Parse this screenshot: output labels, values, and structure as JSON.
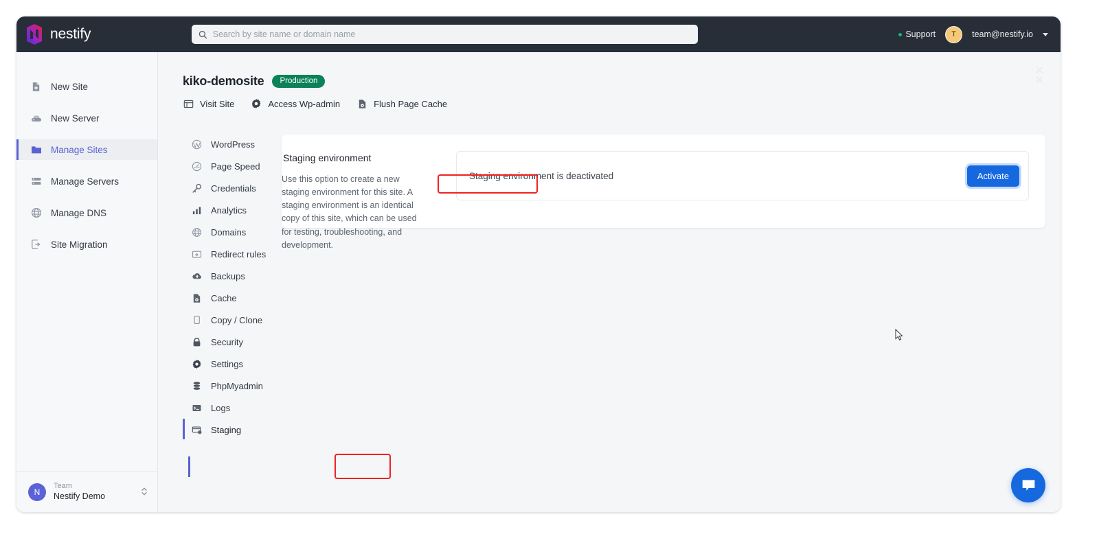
{
  "brand": {
    "name": "nestify",
    "logo_icon": "nestify-logo-icon"
  },
  "topbar": {
    "search": {
      "placeholder": "Search by site name or domain name",
      "value": "",
      "icon": "search-icon"
    },
    "support_label": "Support",
    "user": {
      "avatar_initial": "T",
      "email": "team@nestify.io"
    }
  },
  "sidebar": {
    "items": [
      {
        "label": "New Site",
        "icon": "file-plus-icon",
        "active": false
      },
      {
        "label": "New Server",
        "icon": "server-add-icon",
        "active": false
      },
      {
        "label": "Manage Sites",
        "icon": "folder-icon",
        "active": true
      },
      {
        "label": "Manage Servers",
        "icon": "servers-icon",
        "active": false
      },
      {
        "label": "Manage DNS",
        "icon": "globe-icon",
        "active": false
      },
      {
        "label": "Site Migration",
        "icon": "migration-icon",
        "active": false
      }
    ],
    "team": {
      "avatar_initial": "N",
      "label": "Team",
      "name": "Nestify Demo",
      "switch_icon": "up-down-chevrons-icon"
    }
  },
  "page": {
    "title": "kiko-demosite",
    "env_badge": "Production",
    "close_icon": "close-icon",
    "actions": [
      {
        "label": "Visit Site",
        "icon": "browser-window-icon"
      },
      {
        "label": "Access Wp-admin",
        "icon": "gear-icon"
      },
      {
        "label": "Flush Page Cache",
        "icon": "cache-refresh-icon"
      }
    ]
  },
  "site_nav": {
    "items": [
      {
        "label": "WordPress",
        "icon": "wordpress-icon",
        "active": false
      },
      {
        "label": "Page Speed",
        "icon": "speedometer-icon",
        "active": false
      },
      {
        "label": "Credentials",
        "icon": "key-icon",
        "active": false
      },
      {
        "label": "Analytics",
        "icon": "bar-chart-icon",
        "active": false
      },
      {
        "label": "Domains",
        "icon": "globe-icon",
        "active": false
      },
      {
        "label": "Redirect rules",
        "icon": "redirect-icon",
        "active": false
      },
      {
        "label": "Backups",
        "icon": "cloud-upload-icon",
        "active": false
      },
      {
        "label": "Cache",
        "icon": "cache-icon",
        "active": false
      },
      {
        "label": "Copy / Clone",
        "icon": "copy-icon",
        "active": false
      },
      {
        "label": "Security",
        "icon": "lock-icon",
        "active": false
      },
      {
        "label": "Settings",
        "icon": "gear-icon",
        "active": false
      },
      {
        "label": "PhpMyadmin",
        "icon": "database-icon",
        "active": false
      },
      {
        "label": "Logs",
        "icon": "terminal-icon",
        "active": false
      },
      {
        "label": "Staging",
        "icon": "staging-icon",
        "active": true
      }
    ]
  },
  "main": {
    "section_title": "Staging environment",
    "section_description": "Use this option to create a new staging environment for this site. A staging environment is an identical copy of this site, which can be used for testing, troubleshooting, and development.",
    "status_text": "Staging environment is deactivated",
    "activate_label": "Activate"
  },
  "chat": {
    "icon": "chat-bubble-icon"
  },
  "annotations": {
    "highlight_color": "#ee2222",
    "arrow_color": "#e5281e",
    "targets": [
      "section-title",
      "staging-nav-item",
      "activate-button"
    ]
  },
  "colors": {
    "topbar_bg": "#272e38",
    "page_bg": "#f4f6f8",
    "sidebar_bg": "#f7f8fa",
    "accent_indigo": "#5a62d6",
    "badge_green": "#0b8257",
    "primary_blue": "#1668df",
    "support_dot": "#16b57f"
  }
}
